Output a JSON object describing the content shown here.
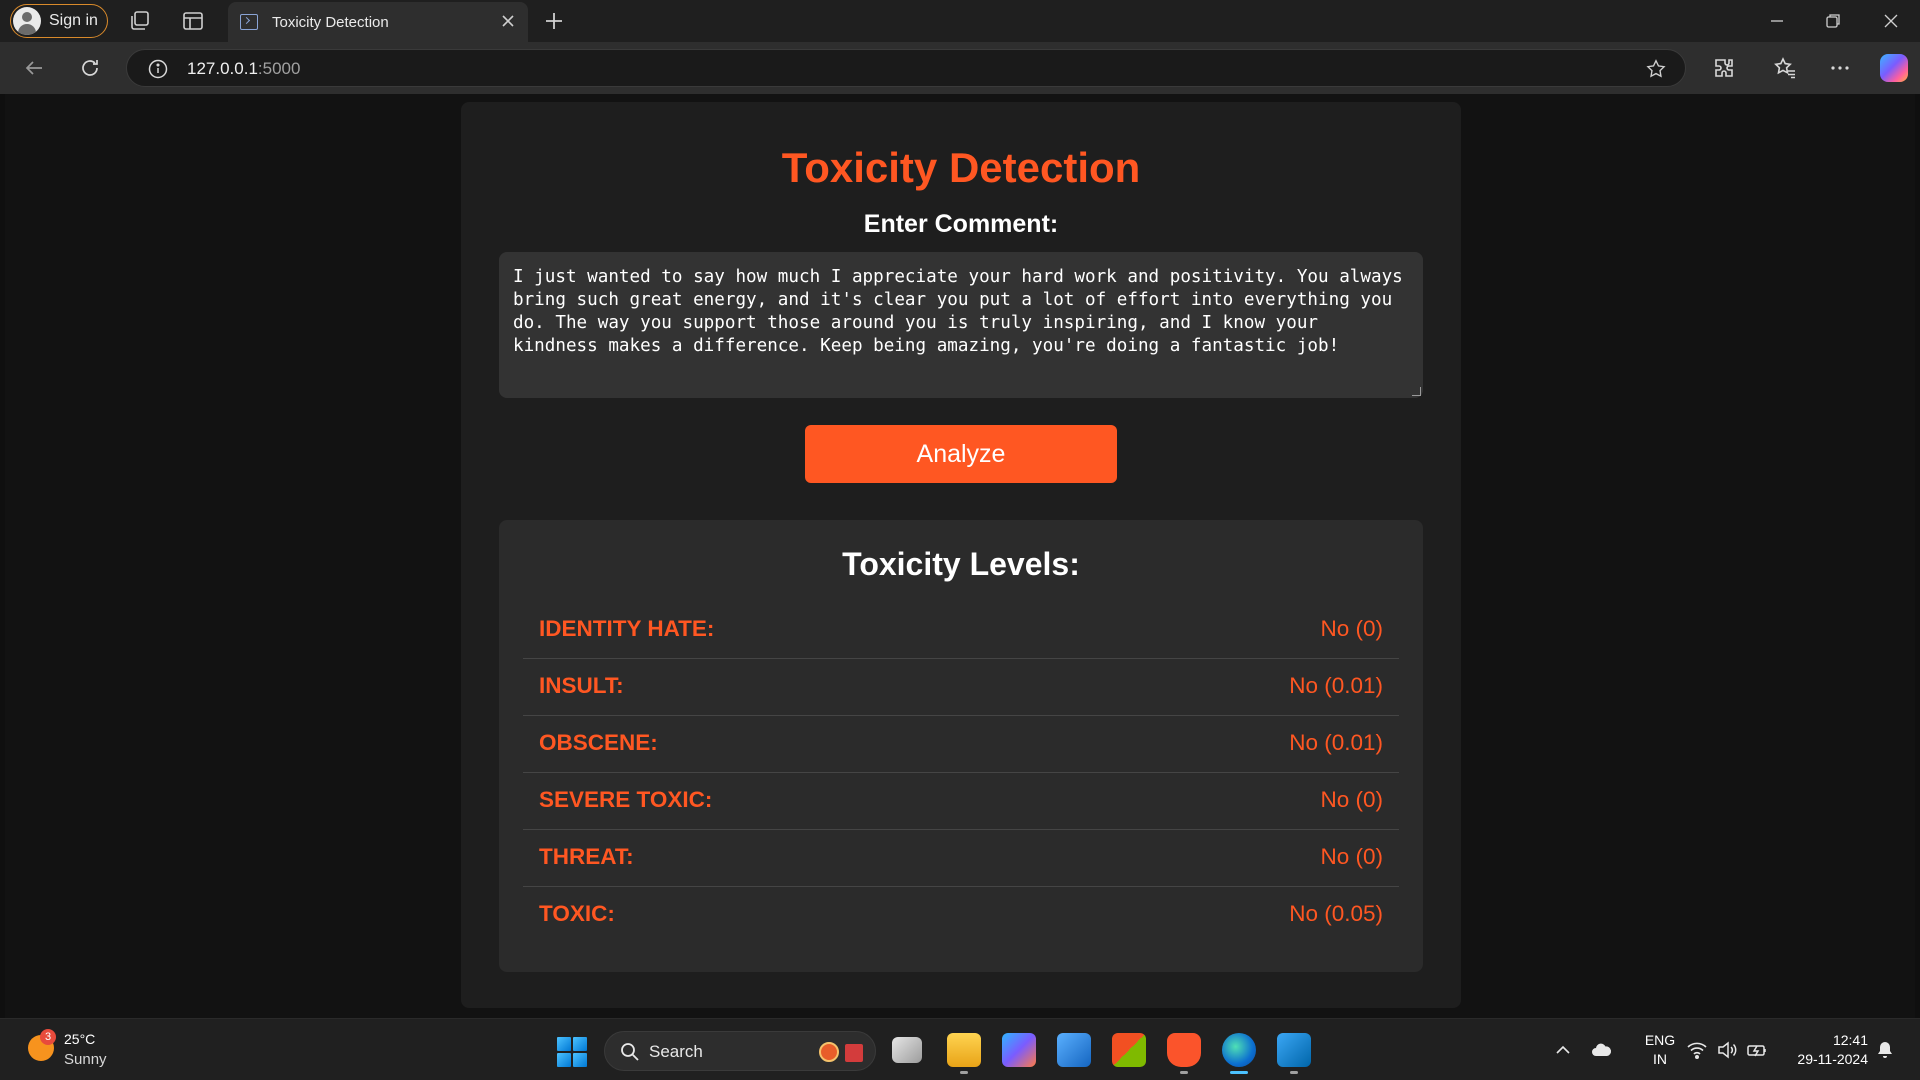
{
  "browser": {
    "signin_label": "Sign in",
    "tab_title": "Toxicity Detection",
    "url_host": "127.0.0.1",
    "url_port": ":5000"
  },
  "app": {
    "title": "Toxicity Detection",
    "comment_label": "Enter Comment:",
    "comment_text": "I just wanted to say how much I appreciate your hard work and positivity. You always bring such great energy, and it's clear you put a lot of effort into everything you do. The way you support those around you is truly inspiring, and I know your kindness makes a difference. Keep being amazing, you're doing a fantastic job!",
    "analyze_label": "Analyze",
    "results_title": "Toxicity Levels:",
    "results": [
      {
        "label": "IDENTITY HATE:",
        "value": "No (0)"
      },
      {
        "label": "INSULT:",
        "value": "No (0.01)"
      },
      {
        "label": "OBSCENE:",
        "value": "No (0.01)"
      },
      {
        "label": "SEVERE TOXIC:",
        "value": "No (0)"
      },
      {
        "label": "THREAT:",
        "value": "No (0)"
      },
      {
        "label": "TOXIC:",
        "value": "No (0.05)"
      }
    ],
    "accent_color": "#ff5722"
  },
  "taskbar": {
    "weather_badge": "3",
    "temperature": "25°C",
    "condition": "Sunny",
    "search_label": "Search",
    "lang_top": "ENG",
    "lang_bottom": "IN",
    "time": "12:41",
    "date": "29-11-2024",
    "pinned_apps": [
      "task-view",
      "file-explorer",
      "copilot",
      "azure-data-studio",
      "microsoft-store",
      "brave-browser",
      "edge-browser",
      "vs-code"
    ]
  }
}
